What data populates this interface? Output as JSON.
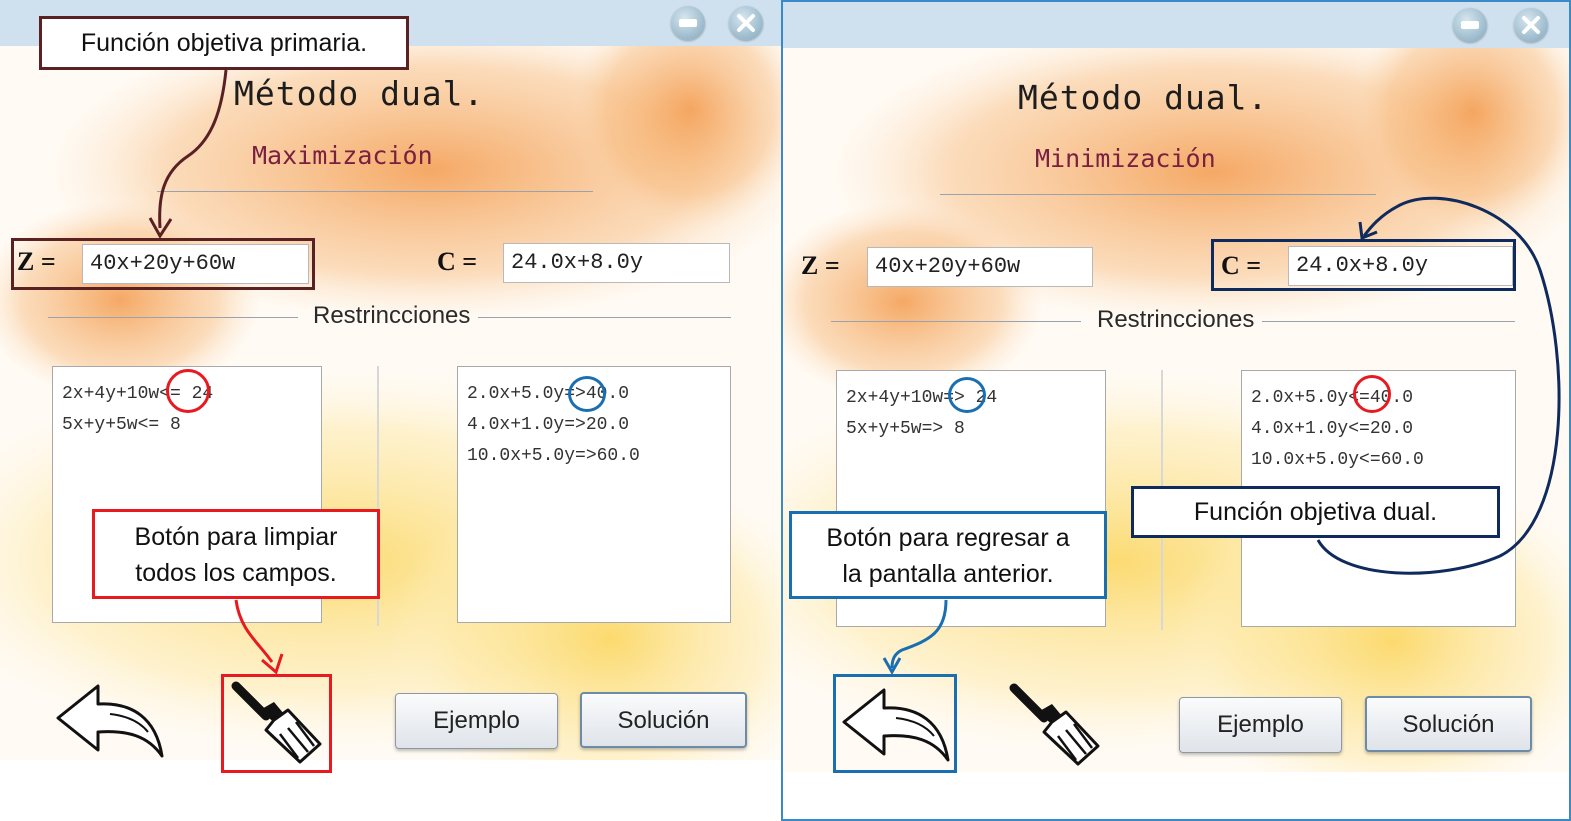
{
  "panels": [
    {
      "title": "Método dual.",
      "subtitle": "Maximización",
      "z_label": "Z =",
      "z_value": "40x+20y+60w",
      "c_label": "C =",
      "c_value": "24.0x+8.0y",
      "restrictions_label": "Restrincciones",
      "left_restrictions": "2x+4y+10w<= 24\n5x+y+5w<= 8",
      "right_restrictions": "2.0x+5.0y=>40.0\n4.0x+1.0y=>20.0\n10.0x+5.0y=>60.0",
      "example_button": "Ejemplo",
      "solution_button": "Solución"
    },
    {
      "title": "Método dual.",
      "subtitle": "Minimización",
      "z_label": "Z =",
      "z_value": "40x+20y+60w",
      "c_label": "C =",
      "c_value": "24.0x+8.0y",
      "restrictions_label": "Restrincciones",
      "left_restrictions": "2x+4y+10w=> 24\n5x+y+5w=> 8",
      "right_restrictions": "2.0x+5.0y<=40.0\n4.0x+1.0y<=20.0\n10.0x+5.0y<=60.0",
      "example_button": "Ejemplo",
      "solution_button": "Solución"
    }
  ],
  "annotations": {
    "primary_objective": "Función objetiva primaria.",
    "clear_button_line1": "Botón para limpiar",
    "clear_button_line2": "todos los campos.",
    "back_button_line1": "Botón para regresar a",
    "back_button_line2": "la pantalla anterior.",
    "dual_objective": "Función objetiva dual."
  },
  "colors": {
    "annotation_brown": "#5a2124",
    "annotation_red": "#e8191f",
    "annotation_blue": "#1a6fb3",
    "annotation_navy": "#0f2a5c",
    "titlebar": "#cfe0ee",
    "subtitle": "#7a2040"
  },
  "icons": [
    "minimize-icon",
    "close-icon",
    "back-arrow-icon",
    "broom-icon"
  ]
}
